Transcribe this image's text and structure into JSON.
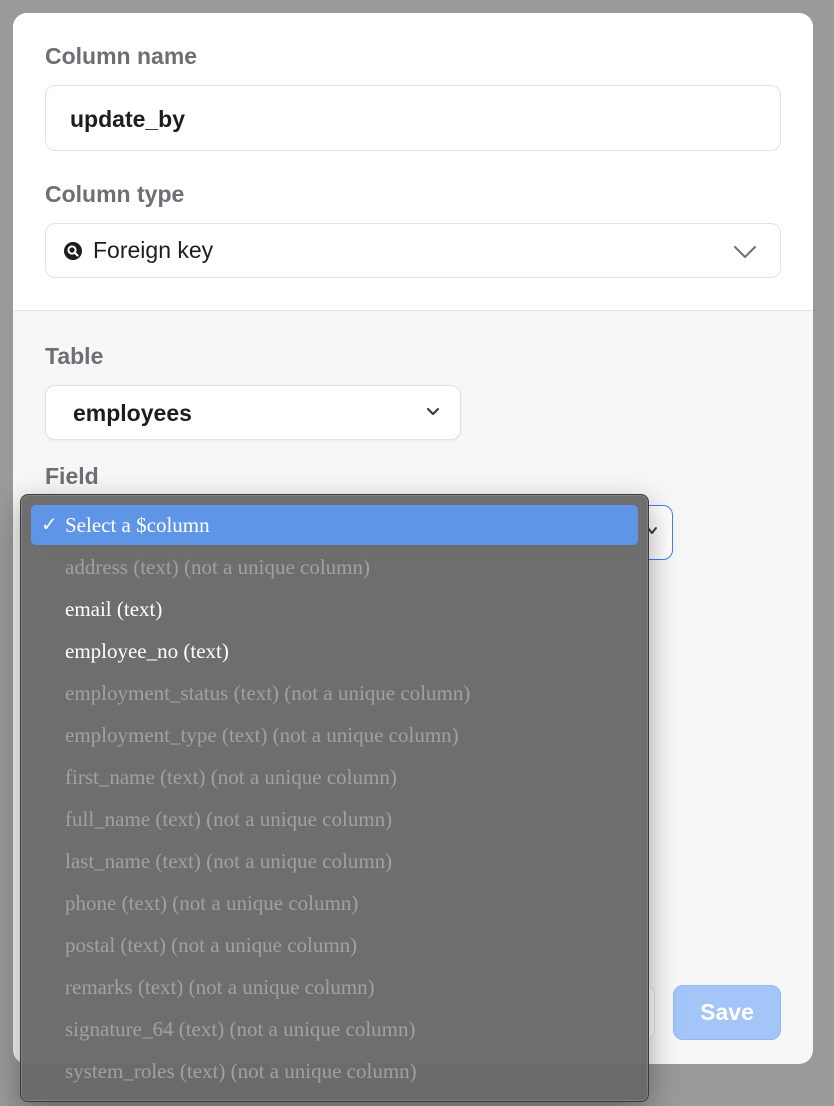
{
  "form": {
    "column_name_label": "Column name",
    "column_name_value": "update_by",
    "column_type_label": "Column type",
    "column_type_value": "Foreign key",
    "column_type_icon": "search-key-icon",
    "table_label": "Table",
    "table_value": "employees",
    "field_label": "Field"
  },
  "buttons": {
    "save_label": "Save"
  },
  "dropdown": {
    "check_glyph": "✓",
    "options": [
      {
        "label": "Select a $column",
        "selected": true,
        "enabled": true
      },
      {
        "label": "address (text) (not a unique column)",
        "selected": false,
        "enabled": false
      },
      {
        "label": "email (text)",
        "selected": false,
        "enabled": true
      },
      {
        "label": "employee_no (text)",
        "selected": false,
        "enabled": true
      },
      {
        "label": "employment_status (text) (not a unique column)",
        "selected": false,
        "enabled": false
      },
      {
        "label": "employment_type (text) (not a unique column)",
        "selected": false,
        "enabled": false
      },
      {
        "label": "first_name (text) (not a unique column)",
        "selected": false,
        "enabled": false
      },
      {
        "label": "full_name (text) (not a unique column)",
        "selected": false,
        "enabled": false
      },
      {
        "label": "last_name (text) (not a unique column)",
        "selected": false,
        "enabled": false
      },
      {
        "label": "phone (text) (not a unique column)",
        "selected": false,
        "enabled": false
      },
      {
        "label": "postal (text) (not a unique column)",
        "selected": false,
        "enabled": false
      },
      {
        "label": "remarks (text) (not a unique column)",
        "selected": false,
        "enabled": false
      },
      {
        "label": "signature_64 (text) (not a unique column)",
        "selected": false,
        "enabled": false
      },
      {
        "label": "system_roles (text) (not a unique column)",
        "selected": false,
        "enabled": false
      }
    ]
  },
  "colors": {
    "accent": "#3b82f6",
    "selected_option": "#5f95e6",
    "save_button": "#a3c5f7"
  }
}
